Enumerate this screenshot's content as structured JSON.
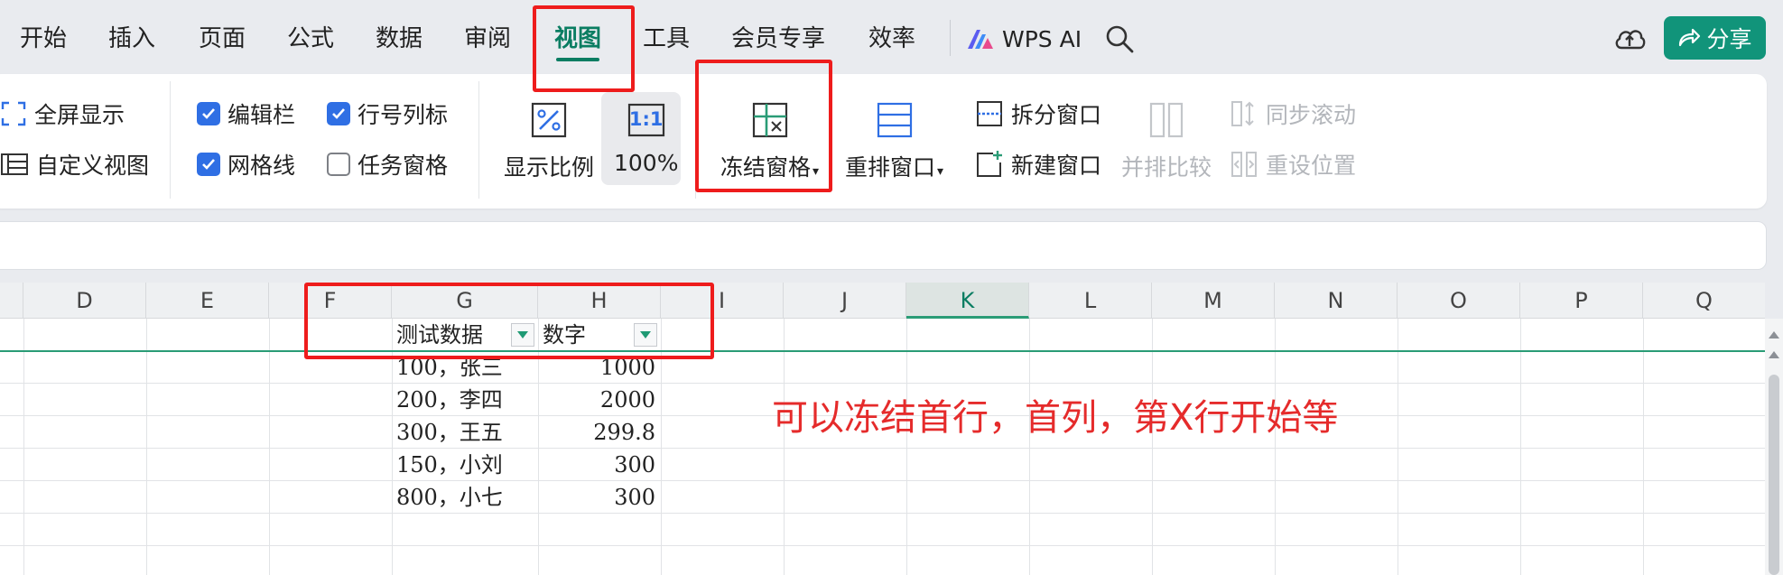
{
  "menu": {
    "items": [
      "开始",
      "插入",
      "页面",
      "公式",
      "数据",
      "审阅",
      "视图",
      "工具",
      "会员专享",
      "效率"
    ],
    "active": "视图",
    "wps_ai": "WPS AI",
    "share": "分享"
  },
  "ribbon": {
    "fullscreen": "全屏显示",
    "custom_view": "自定义视图",
    "edit_bar": {
      "label": "编辑栏",
      "checked": true
    },
    "row_col_header": {
      "label": "行号列标",
      "checked": true
    },
    "gridlines": {
      "label": "网格线",
      "checked": true
    },
    "task_pane": {
      "label": "任务窗格",
      "checked": false
    },
    "zoom_ratio": "显示比例",
    "zoom_100": "100%",
    "zoom_100_icon_text": "1:1",
    "freeze_panes": "冻结窗格",
    "rearrange": "重排窗口",
    "split_window": "拆分窗口",
    "new_window": "新建窗口",
    "side_by_side": "并排比较",
    "sync_scroll": "同步滚动",
    "reset_position": "重设位置"
  },
  "sheet": {
    "columns": [
      "D",
      "E",
      "F",
      "G",
      "H",
      "I",
      "J",
      "K",
      "L",
      "M",
      "N",
      "O",
      "P",
      "Q"
    ],
    "selected_column": "K",
    "headers": {
      "g": "测试数据",
      "h": "数字"
    },
    "rows": [
      {
        "g": "100，张三",
        "h": "1000"
      },
      {
        "g": "200，李四",
        "h": "2000"
      },
      {
        "g": "300，王五",
        "h": "299.8"
      },
      {
        "g": "150，小刘",
        "h": "300"
      },
      {
        "g": "800，小七",
        "h": "300"
      }
    ],
    "annotation": "可以冻结首行，首列，第X行开始等"
  },
  "colors": {
    "accent": "#0a7d62",
    "share_bg": "#11947a",
    "checkbox": "#2f6fe4",
    "annotation": "#e52b2b",
    "highlight_box": "#ee1c1c"
  }
}
